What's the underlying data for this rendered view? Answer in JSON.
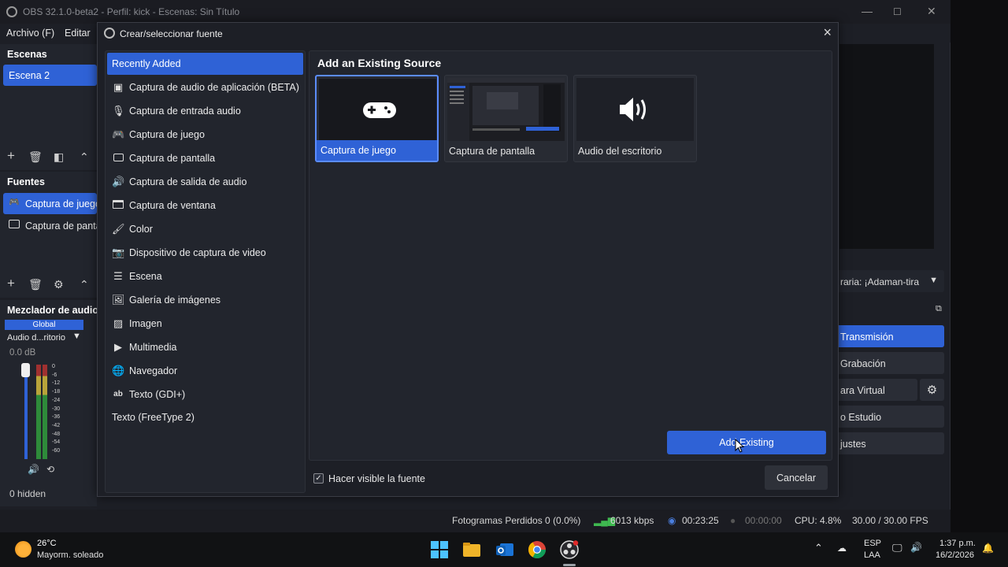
{
  "window": {
    "title": "OBS 32.1.0-beta2 - Perfil: kick - Escenas: Sin Título",
    "menu": [
      "Archivo (F)",
      "Editar"
    ]
  },
  "scenes": {
    "header": "Escenas",
    "items": [
      "Escena 2"
    ]
  },
  "sources": {
    "header": "Fuentes",
    "items": [
      "Captura de juego",
      "Captura de pantalla"
    ]
  },
  "mixer": {
    "header": "Mezclador de audio",
    "tab": "Global",
    "channel": "Audio d...ritorio",
    "db": "0.0 dB",
    "scale": [
      "0",
      "-6",
      "-12",
      "-18",
      "-24",
      "-30",
      "-36",
      "-42",
      "-48",
      "-54",
      "-60"
    ],
    "hidden": "0 hidden"
  },
  "controls": {
    "profile_select": "raria: ¡Adaman-tira",
    "buttons": [
      "Transmisión",
      "Grabación",
      "ara Virtual",
      "o Estudio",
      "justes"
    ]
  },
  "statusbar": {
    "frames": "Fotogramas Perdidos 0 (0.0%)",
    "bitrate": "6013 kbps",
    "stream_time": "00:23:25",
    "rec_time": "00:00:00",
    "cpu": "CPU: 4.8%",
    "fps": "30.00 / 30.00 FPS"
  },
  "dialog": {
    "title": "Crear/seleccionar fuente",
    "source_types": [
      {
        "label": "Recently Added",
        "icon": "none"
      },
      {
        "label": "Captura de audio de aplicación (BETA)",
        "icon": "app-audio-icon"
      },
      {
        "label": "Captura de entrada audio",
        "icon": "microphone-icon"
      },
      {
        "label": "Captura de juego",
        "icon": "gamepad-icon"
      },
      {
        "label": "Captura de pantalla",
        "icon": "monitor-icon"
      },
      {
        "label": "Captura de salida de audio",
        "icon": "speaker-icon"
      },
      {
        "label": "Captura de ventana",
        "icon": "window-icon"
      },
      {
        "label": "Color",
        "icon": "brush-icon"
      },
      {
        "label": "Dispositivo de captura de video",
        "icon": "camera-icon"
      },
      {
        "label": "Escena",
        "icon": "list-icon"
      },
      {
        "label": "Galería de imágenes",
        "icon": "slideshow-icon"
      },
      {
        "label": "Imagen",
        "icon": "image-icon"
      },
      {
        "label": "Multimedia",
        "icon": "play-icon"
      },
      {
        "label": "Navegador",
        "icon": "globe-icon"
      },
      {
        "label": "Texto (GDI+)",
        "icon": "text-icon"
      },
      {
        "label": "Texto (FreeType 2)",
        "icon": "none"
      }
    ],
    "existing_header": "Add an Existing Source",
    "existing_sources": [
      "Captura de juego",
      "Captura de pantalla",
      "Audio del escritorio"
    ],
    "add_button": "Add Existing",
    "visible_checkbox": "Hacer visible la fuente",
    "visible_checked": true,
    "cancel_button": "Cancelar"
  },
  "taskbar": {
    "temperature": "26°C",
    "condition": "Mayorm. soleado",
    "language_1": "ESP",
    "language_2": "LAA",
    "time": "1:37 p.m.",
    "date": "16/2/2026",
    "apps": [
      "windows-start-icon",
      "file-explorer-icon",
      "outlook-icon",
      "chrome-icon",
      "obs-icon"
    ]
  },
  "colors": {
    "accent": "#2f62d6",
    "background": "#1d1f26",
    "panel": "#22252d"
  }
}
